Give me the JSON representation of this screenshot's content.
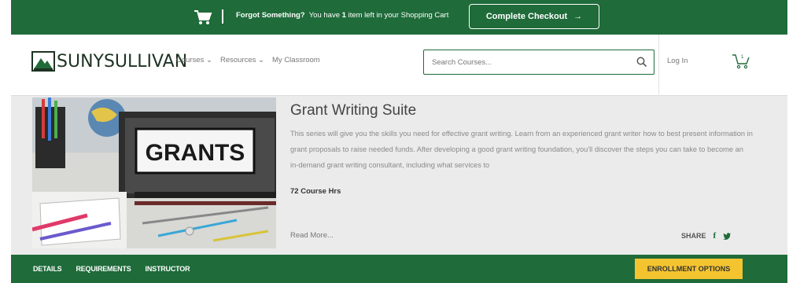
{
  "banner": {
    "forgot_label": "Forgot Something?",
    "message_prefix": "You have",
    "item_count": "1",
    "message_suffix": "item left in your Shopping Cart",
    "checkout_label": "Complete Checkout",
    "checkout_arrow": "→"
  },
  "header": {
    "logo_text": "SUNYSULLIVAN",
    "nav": [
      {
        "label": "Courses",
        "caret": "⌄"
      },
      {
        "label": "Resources",
        "caret": "⌄"
      },
      {
        "label": "My Classroom"
      }
    ],
    "search_placeholder": "Search Courses...",
    "login_label": "Log In",
    "cart_count": "1"
  },
  "course": {
    "title": "Grant Writing Suite",
    "description": "This series will give you the skills you need for effective grant writing. Learn from an experienced grant writer how to best present information in grant proposals to raise needed funds. After developing a good grant writing foundation, you'll discover the steps you can take to become an in-demand grant writing consultant, including what services to",
    "hours": "72 Course Hrs",
    "read_more": "Read More...",
    "share_label": "SHARE",
    "image_label": "GRANTS"
  },
  "tabs": [
    {
      "label": "DETAILS"
    },
    {
      "label": "REQUIREMENTS"
    },
    {
      "label": "INSTRUCTOR"
    }
  ],
  "enroll_label": "ENROLLMENT OPTIONS",
  "colors": {
    "brand_green": "#1f6b3a",
    "accent_yellow": "#f4c430",
    "hero_bg": "#ebebeb"
  }
}
